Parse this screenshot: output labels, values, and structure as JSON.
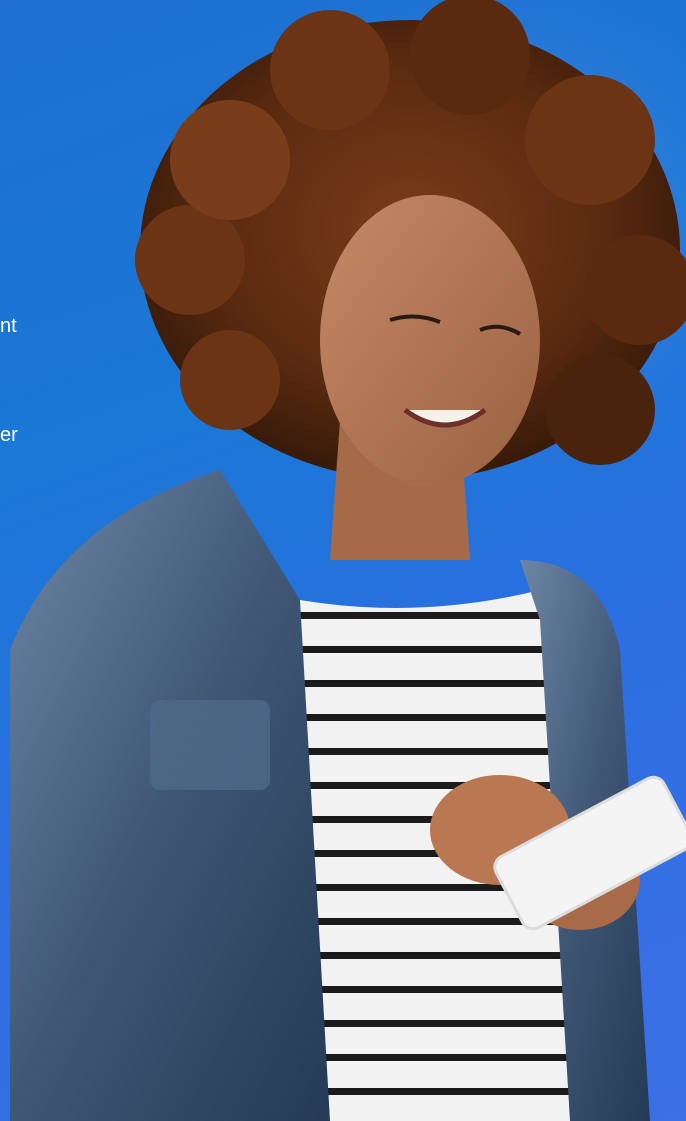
{
  "hero": {
    "text_fragments": [
      "nt",
      "er"
    ],
    "image": {
      "description_icon": "woman-using-phone-photo"
    },
    "colors": {
      "background": "#1e74d4",
      "text": "#ffffff"
    }
  }
}
